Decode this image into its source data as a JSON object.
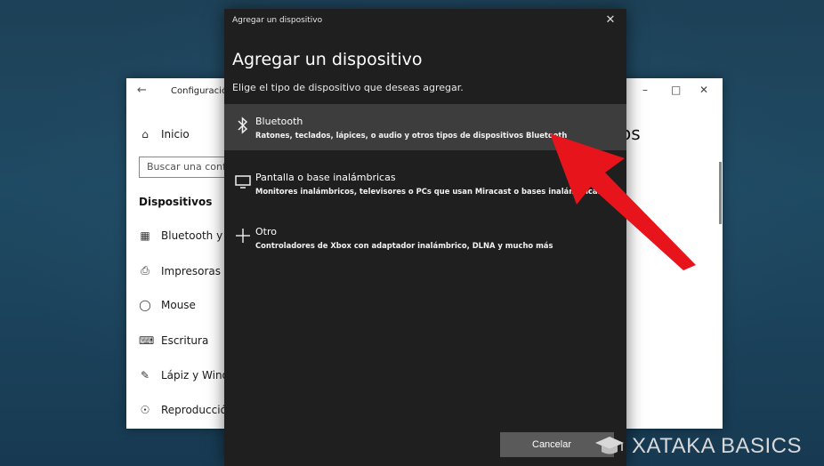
{
  "settings_window": {
    "title": "Configuración",
    "home": "Inicio",
    "search_placeholder": "Buscar una configuración",
    "section": "Dispositivos",
    "partial_heading": "os",
    "nav_items": [
      {
        "label": "Bluetooth y otros dispositivos",
        "icon": "bluetooth-devices-icon"
      },
      {
        "label": "Impresoras y escáneres",
        "icon": "printer-icon"
      },
      {
        "label": "Mouse",
        "icon": "mouse-icon"
      },
      {
        "label": "Escritura",
        "icon": "keyboard-icon"
      },
      {
        "label": "Lápiz y Windows Ink",
        "icon": "pen-icon"
      },
      {
        "label": "Reproducción automática",
        "icon": "autoplay-icon"
      }
    ]
  },
  "dialog": {
    "titlebar": "Agregar un dispositivo",
    "heading": "Agregar un dispositivo",
    "subtitle": "Elige el tipo de dispositivo que deseas agregar.",
    "options": [
      {
        "title": "Bluetooth",
        "desc": "Ratones, teclados, lápices, o audio y otros tipos de dispositivos Bluetooth",
        "icon": "bluetooth-icon"
      },
      {
        "title": "Pantalla o base inalámbricas",
        "desc": "Monitores inalámbricos, televisores o PCs que usan Miracast o bases inalámbricas",
        "icon": "monitor-icon"
      },
      {
        "title": "Otro",
        "desc": "Controladores de Xbox con adaptador inalámbrico, DLNA y mucho más",
        "icon": "plus-icon"
      }
    ],
    "cancel_label": "Cancelar"
  },
  "watermark": {
    "text": "XATAKA BASICS"
  },
  "colors": {
    "dialog_bg": "#1f1f1f",
    "selected_bg": "#3d3d3d",
    "arrow": "#e8141b"
  }
}
